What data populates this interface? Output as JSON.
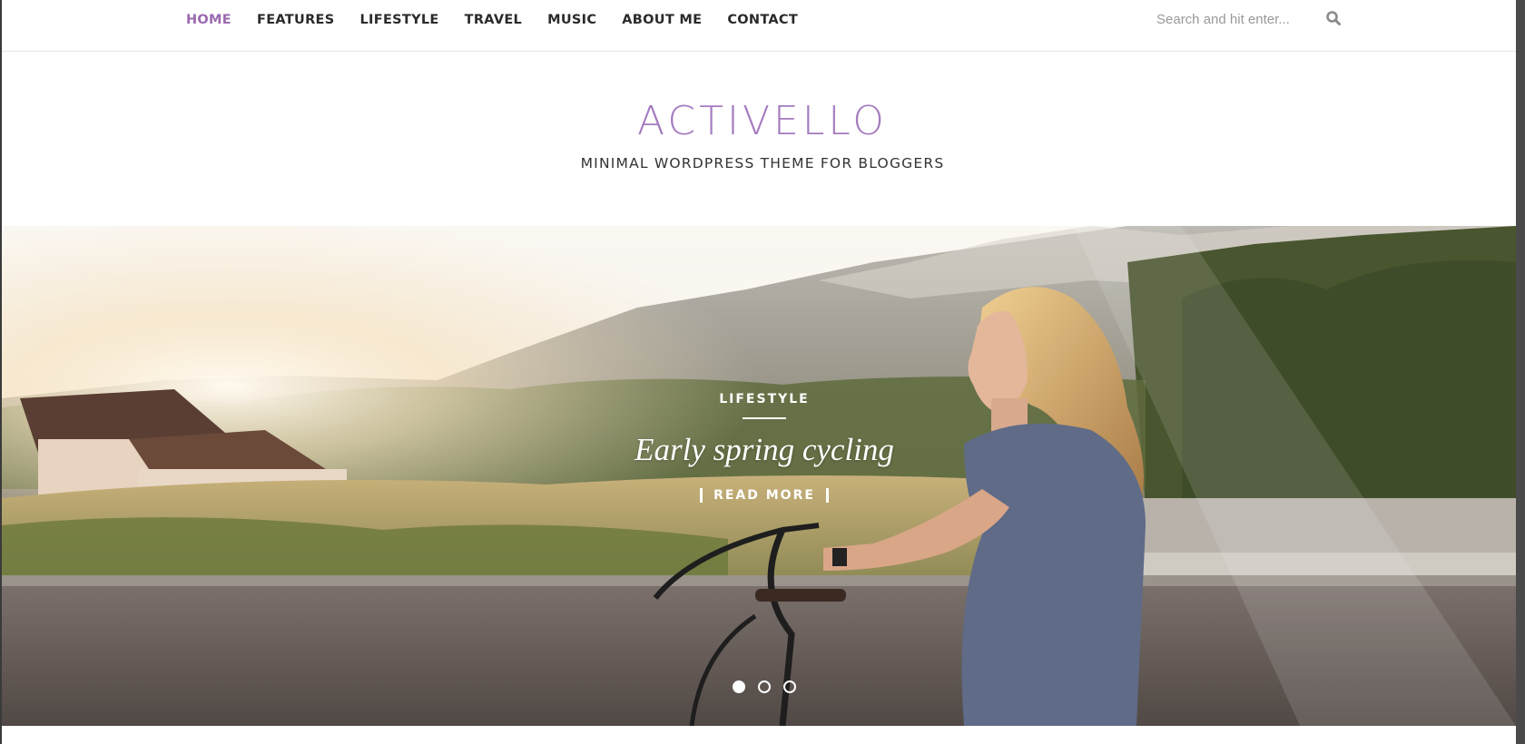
{
  "nav": {
    "items": [
      {
        "label": "HOME",
        "active": true
      },
      {
        "label": "FEATURES"
      },
      {
        "label": "LIFESTYLE"
      },
      {
        "label": "TRAVEL"
      },
      {
        "label": "MUSIC"
      },
      {
        "label": "ABOUT ME"
      },
      {
        "label": "CONTACT"
      }
    ]
  },
  "search": {
    "placeholder": "Search and hit enter...",
    "icon": "search-icon"
  },
  "brand": {
    "logo": "ACTIVELLO",
    "tagline": "MINIMAL WORDPRESS THEME FOR BLOGGERS"
  },
  "slider": {
    "category": "LIFESTYLE",
    "title": "Early spring cycling",
    "read_more": "READ MORE",
    "slide_count": 3,
    "active_slide": 1
  },
  "colors": {
    "accent": "#9b6ab0",
    "logo": "#a47bbf",
    "text": "#2a2a2a"
  }
}
